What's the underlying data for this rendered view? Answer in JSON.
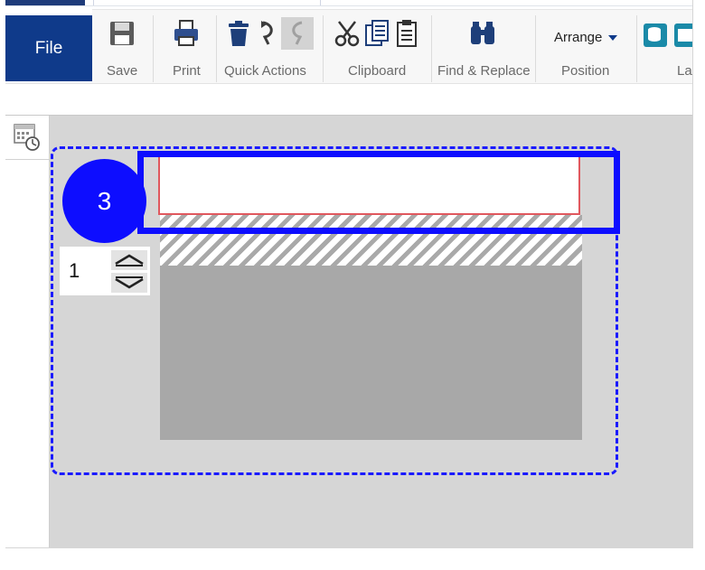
{
  "ribbon": {
    "file_label": "File",
    "groups": {
      "save": "Save",
      "print": "Print",
      "quick_actions": "Quick Actions",
      "clipboard": "Clipboard",
      "find_replace": "Find & Replace",
      "position": "Position",
      "layout_partial": "La"
    },
    "arrange_label": "Arrange"
  },
  "canvas": {
    "step_number": "3",
    "page_number": "1"
  },
  "colors": {
    "file_button": "#0f3a8a",
    "callout_blue": "#0d0dff",
    "field_border": "#e0585e",
    "canvas_bg": "#d6d6d6"
  }
}
